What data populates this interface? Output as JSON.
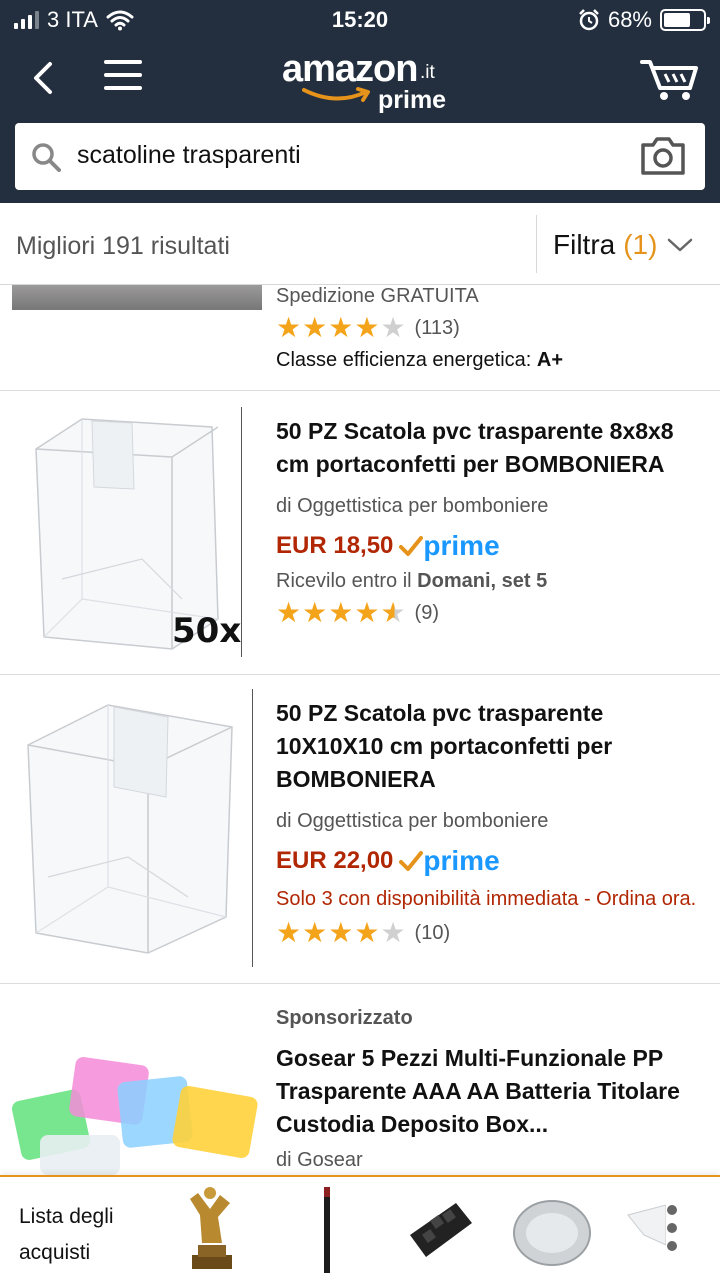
{
  "status": {
    "carrier": "3 ITA",
    "time": "15:20",
    "battery": "68%"
  },
  "header": {
    "logo_word": "amazon",
    "logo_tld": ".it",
    "logo_prime": "prime"
  },
  "search": {
    "query": "scatoline trasparenti"
  },
  "results": {
    "count_label": "Migliori 191 risultati",
    "filter_label": "Filtra",
    "filter_count": "(1)"
  },
  "prev_item": {
    "shipping": "Spedizione GRATUITA",
    "rating": 4,
    "reviews": "(113)",
    "energy_label": "Classe efficienza energetica:",
    "energy_value": "A+"
  },
  "items": [
    {
      "title": "50 PZ Scatola pvc trasparente 8x8x8 cm portaconfetti per BOMBONIERA",
      "seller": "di Oggettistica per bomboniere",
      "price": "EUR 18,50",
      "prime": "prime",
      "delivery_prefix": "Ricevilo entro il",
      "delivery_date": "Domani, set 5",
      "image_badge": "50x",
      "rating": 4.5,
      "reviews": "(9)"
    },
    {
      "title": "50 PZ Scatola pvc trasparente 10X10X10 cm portaconfetti per BOMBONIERA",
      "seller": "di Oggettistica per bomboniere",
      "price": "EUR 22,00",
      "prime": "prime",
      "stock": "Solo 3 con disponibilità immediata - Ordina ora.",
      "rating": 4,
      "reviews": "(10)"
    },
    {
      "sponsored": "Sponsorizzato",
      "title": "Gosear 5 Pezzi Multi-Funzionale PP Trasparente AAA AA Batteria Titolare Custodia Deposito Box...",
      "seller": "di Gosear"
    }
  ],
  "bottom": {
    "list_label": "Lista degli acquisti"
  },
  "colors": {
    "header_bg": "#232f3e",
    "accent": "#e5931b",
    "price": "#b12704",
    "prime_blue": "#1a98ff",
    "star": "#f4a41b"
  }
}
